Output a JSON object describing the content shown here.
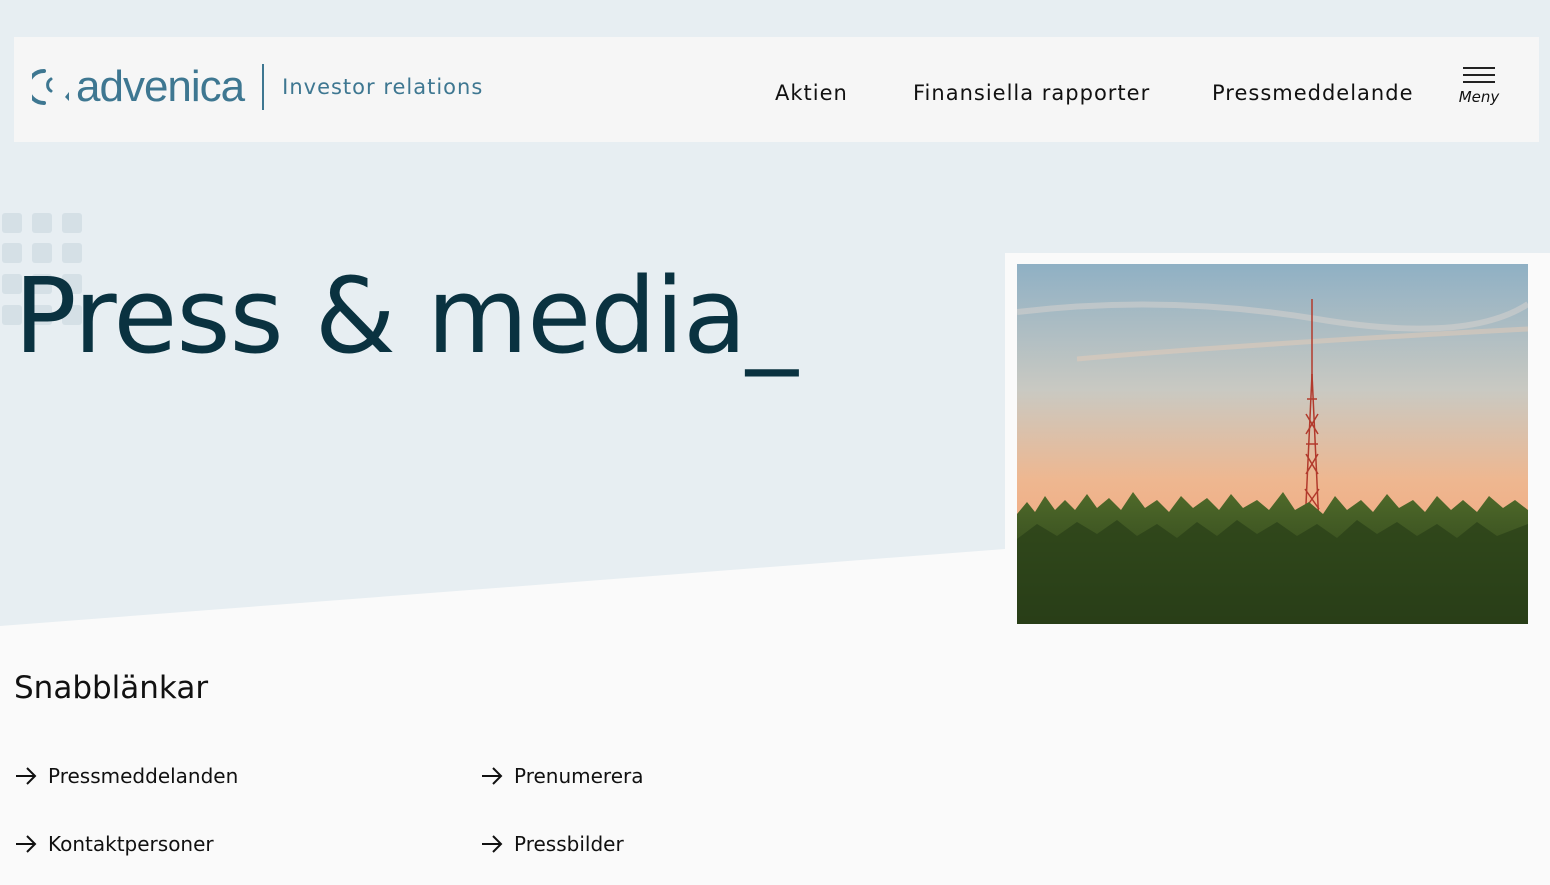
{
  "header": {
    "logo_text": "advenica",
    "logo_subtitle": "Investor relations",
    "nav": [
      {
        "label": "Aktien"
      },
      {
        "label": "Finansiella rapporter"
      },
      {
        "label": "Pressmeddelande"
      }
    ],
    "menu_label": "Meny"
  },
  "hero": {
    "title": "Press & media_",
    "image_alt_icon": "radio-tower-photo"
  },
  "quicklinks": {
    "title": "Snabblänkar",
    "items": [
      {
        "label": "Pressmeddelanden",
        "icon": "arrow-right-icon"
      },
      {
        "label": "Prenumerera",
        "icon": "arrow-right-icon"
      },
      {
        "label": "Kontaktpersoner",
        "icon": "arrow-right-icon"
      },
      {
        "label": "Pressbilder",
        "icon": "arrow-right-icon"
      }
    ]
  },
  "colors": {
    "brand": "#3e7791",
    "title": "#0a3240",
    "page_bg": "#e7eef2",
    "header_bg": "#f6f6f6"
  }
}
